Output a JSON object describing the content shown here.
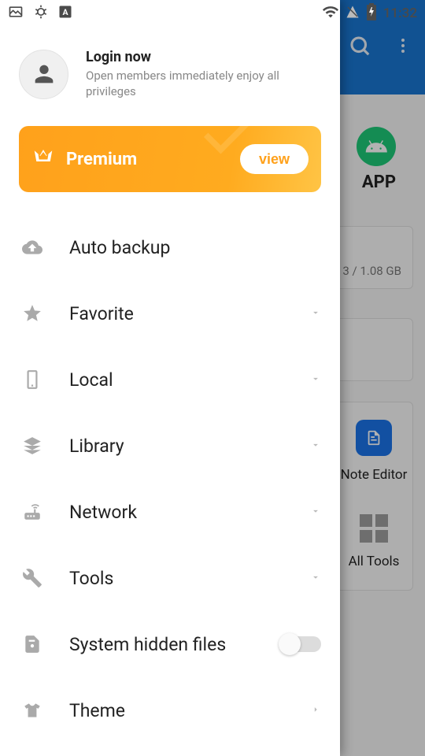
{
  "status_bar": {
    "time": "11:32"
  },
  "login": {
    "title": "Login now",
    "subtitle": "Open members immediately enjoy all privileges"
  },
  "premium": {
    "label": "Premium",
    "button": "view"
  },
  "menu": {
    "auto_backup": "Auto backup",
    "favorite": "Favorite",
    "local": "Local",
    "library": "Library",
    "network": "Network",
    "tools": "Tools",
    "hidden_files": "System hidden files",
    "theme": "Theme"
  },
  "background": {
    "app_label": "APP",
    "storage": "3 / 1.08 GB",
    "note_editor": "Note Editor",
    "all_tools": "All Tools"
  }
}
